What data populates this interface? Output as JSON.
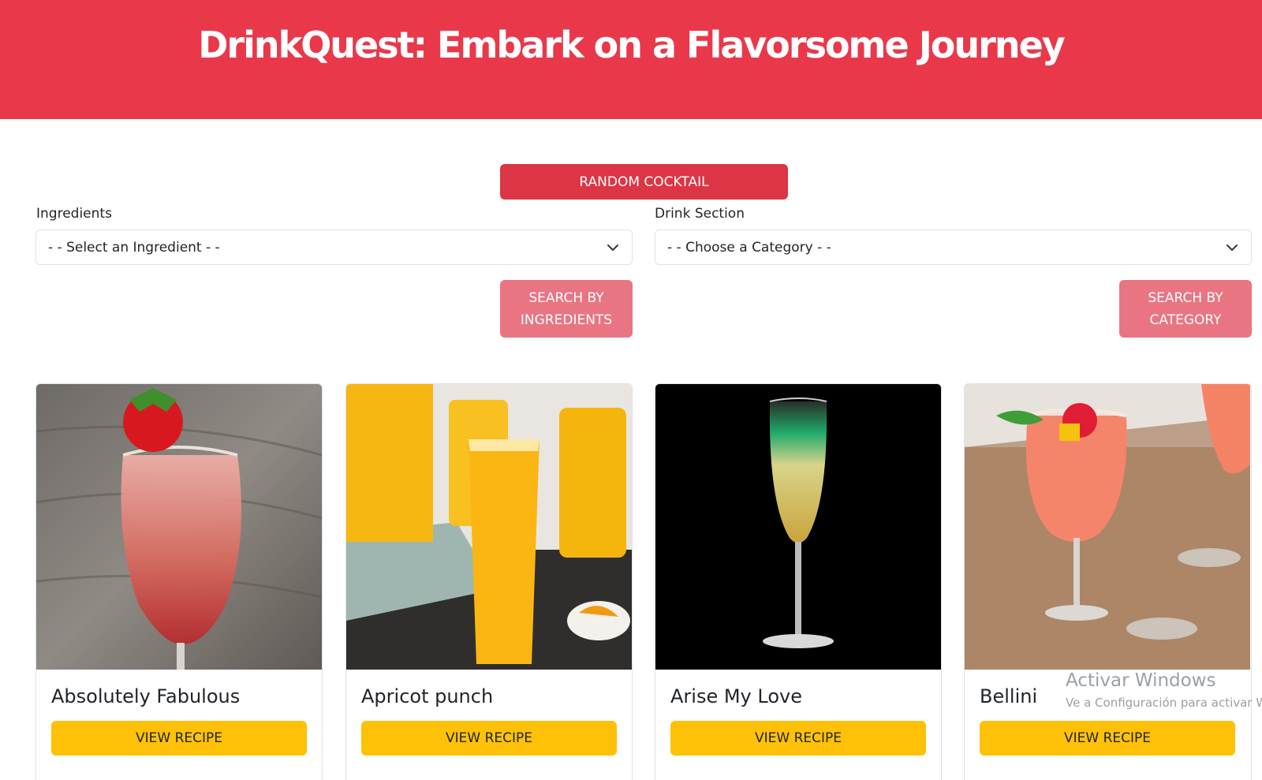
{
  "header": {
    "title": "DrinkQuest: Embark on a Flavorsome Journey"
  },
  "random_button": "RANDOM COCKTAIL",
  "ingredients": {
    "label": "Ingredients",
    "placeholder": "- - Select an Ingredient - -",
    "search_label_line1": "SEARCH BY",
    "search_label_line2": "INGREDIENTS"
  },
  "category": {
    "label": "Drink Section",
    "placeholder": "- - Choose a Category - -",
    "search_label_line1": "SEARCH BY",
    "search_label_line2": "CATEGORY"
  },
  "cards": [
    {
      "title": "Absolutely Fabulous",
      "button": "VIEW RECIPE"
    },
    {
      "title": "Apricot punch",
      "button": "VIEW RECIPE"
    },
    {
      "title": "Arise My Love",
      "button": "VIEW RECIPE"
    },
    {
      "title": "Bellini",
      "button": "VIEW RECIPE"
    }
  ],
  "os_watermark": {
    "line1": "Activar Windows",
    "line2": "Ve a Configuración para activar W"
  },
  "colors": {
    "header_bg": "#ea384b",
    "primary_button": "#dc3545",
    "search_button": "#e97583",
    "view_button": "#ffc107"
  }
}
